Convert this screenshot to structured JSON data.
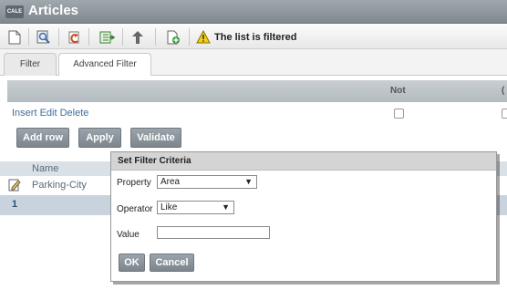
{
  "app": {
    "logo_text": "CALE",
    "title": "Articles"
  },
  "toolbar": {
    "buttons": [
      "new-icon",
      "search-icon",
      "undo-icon",
      "export-icon",
      "pin-icon",
      "add-page-icon"
    ],
    "status_text": "The list is filtered",
    "warning_icon": "warning-icon"
  },
  "tabs": [
    {
      "label": "Filter",
      "active": false
    },
    {
      "label": "Advanced Filter",
      "active": true
    }
  ],
  "criteria": {
    "columns": {
      "not": "Not",
      "paren": "("
    },
    "row_actions": "Insert Edit Delete",
    "buttons": {
      "add_row": "Add row",
      "apply": "Apply",
      "validate": "Validate"
    }
  },
  "grid": {
    "header": "Name",
    "rows": [
      {
        "icon": "edit-icon",
        "name": "Parking-City"
      }
    ],
    "footer": "1"
  },
  "dialog": {
    "title": "Set Filter Criteria",
    "property_label": "Property",
    "property_value": "Area",
    "operator_label": "Operator",
    "operator_value": "Like",
    "value_label": "Value",
    "value_value": "",
    "ok_label": "OK",
    "cancel_label": "Cancel"
  },
  "colors": {
    "titlebar": "#8a9399",
    "button": "#8a9399",
    "link": "#3e6d9c",
    "grid_header": "#d9e0e6"
  }
}
